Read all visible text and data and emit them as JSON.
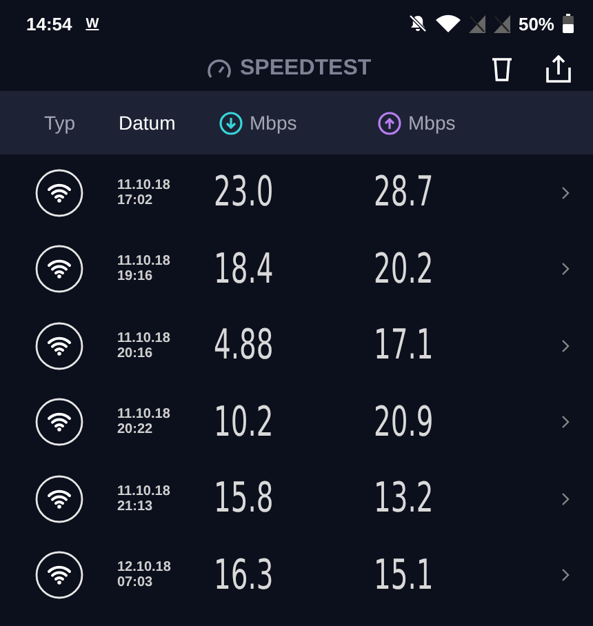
{
  "status_bar": {
    "time": "14:54",
    "notification": "W",
    "battery": "50%"
  },
  "app_bar": {
    "title": "SPEEDTEST"
  },
  "table": {
    "columns": [
      {
        "label": "Typ",
        "kind": "plain",
        "selected": false
      },
      {
        "label": "Datum",
        "kind": "plain",
        "selected": true
      },
      {
        "label": "Mbps",
        "kind": "download",
        "selected": false
      },
      {
        "label": "Mbps",
        "kind": "upload",
        "selected": false
      }
    ],
    "rows": [
      {
        "date": "11.10.18",
        "time": "17:02",
        "download": "23.0",
        "upload": "28.7"
      },
      {
        "date": "11.10.18",
        "time": "19:16",
        "download": "18.4",
        "upload": "20.2"
      },
      {
        "date": "11.10.18",
        "time": "20:16",
        "download": "4.88",
        "upload": "17.1"
      },
      {
        "date": "11.10.18",
        "time": "20:22",
        "download": "10.2",
        "upload": "20.9"
      },
      {
        "date": "11.10.18",
        "time": "21:13",
        "download": "15.8",
        "upload": "13.2"
      },
      {
        "date": "12.10.18",
        "time": "07:03",
        "download": "16.3",
        "upload": "15.1"
      }
    ]
  }
}
